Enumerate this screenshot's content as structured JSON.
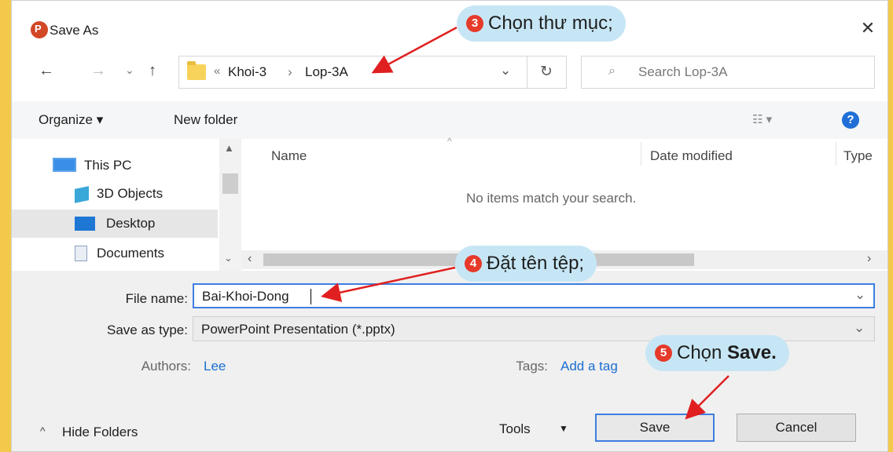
{
  "window": {
    "title": "Save As",
    "app_icon_letter": "P"
  },
  "address": {
    "prefix": "«",
    "crumbs": [
      "Khoi-3",
      "Lop-3A"
    ],
    "separator": "›"
  },
  "search": {
    "placeholder": "Search Lop-3A"
  },
  "toolbar": {
    "organize": "Organize ▾",
    "new_folder": "New folder",
    "help": "?"
  },
  "nav_pane": {
    "items": [
      {
        "label": "This PC",
        "icon": "monitor-icon",
        "selected": false
      },
      {
        "label": "3D Objects",
        "icon": "cube-icon",
        "selected": false
      },
      {
        "label": "Desktop",
        "icon": "desktop-icon",
        "selected": true
      },
      {
        "label": "Documents",
        "icon": "document-icon",
        "selected": false
      }
    ]
  },
  "file_list": {
    "columns": [
      "Name",
      "Date modified",
      "Type"
    ],
    "empty_message": "No items match your search."
  },
  "fields": {
    "file_name_label": "File name:",
    "file_name_value": "Bai-Khoi-Dong",
    "save_type_label": "Save as type:",
    "save_type_value": "PowerPoint Presentation (*.pptx)",
    "authors_label": "Authors:",
    "authors_value": "Lee",
    "tags_label": "Tags:",
    "tags_value": "Add a tag"
  },
  "footer": {
    "hide_folders": "Hide Folders",
    "tools": "Tools",
    "save": "Save",
    "cancel": "Cancel"
  },
  "callouts": [
    {
      "number": "3",
      "text": "Chọn thư mục;"
    },
    {
      "number": "4",
      "text": "Đặt tên tệp;"
    },
    {
      "number": "5",
      "text_prefix": "Chọn ",
      "text_bold": "Save."
    }
  ],
  "colors": {
    "accent": "#3d7ee0",
    "callout_bg": "#c7e6f5",
    "badge": "#e63a2a",
    "arrow": "#e02020",
    "page_bg": "#f2c94a"
  }
}
